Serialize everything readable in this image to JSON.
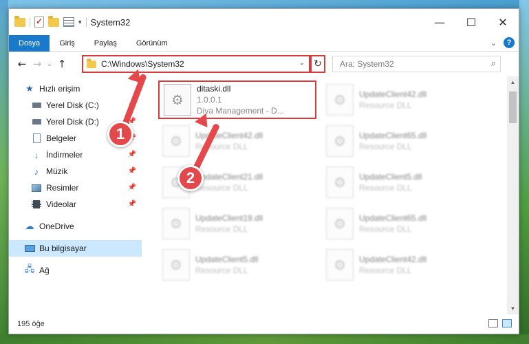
{
  "window": {
    "title": "System32",
    "controls": {
      "minimize": "—",
      "maximize": "☐",
      "close": "✕"
    }
  },
  "ribbon": {
    "tabs": [
      "Dosya",
      "Giriş",
      "Paylaş",
      "Görünüm"
    ],
    "active_tab": "Dosya",
    "help": "?"
  },
  "navigation": {
    "back": "←",
    "forward": "→",
    "recent": "⌄",
    "up": "↑",
    "address": "C:\\Windows\\System32",
    "refresh": "↻",
    "search_placeholder": "Ara: System32"
  },
  "sidebar": {
    "items": [
      {
        "label": "Hızlı erişim",
        "icon": "star-icon"
      },
      {
        "label": "Yerel Disk (C:)",
        "icon": "drive-icon",
        "pinned": true
      },
      {
        "label": "Yerel Disk (D:)",
        "icon": "drive-icon",
        "pinned": true
      },
      {
        "label": "Belgeler",
        "icon": "documents-icon",
        "pinned": true
      },
      {
        "label": "İndirmeler",
        "icon": "download-icon",
        "pinned": true
      },
      {
        "label": "Müzik",
        "icon": "music-icon",
        "pinned": true
      },
      {
        "label": "Resimler",
        "icon": "pictures-icon",
        "pinned": true
      },
      {
        "label": "Videolar",
        "icon": "videos-icon",
        "pinned": true
      },
      {
        "label": "OneDrive",
        "icon": "onedrive-icon"
      },
      {
        "label": "Bu bilgisayar",
        "icon": "computer-icon",
        "selected": true
      },
      {
        "label": "Ağ",
        "icon": "network-icon"
      }
    ]
  },
  "files": [
    {
      "name": "ditaski.dll",
      "line2": "1.0.0.1",
      "line3": "Diva Management - D...",
      "highlighted": true
    },
    {
      "name": "UpdateClient42.dll",
      "line2": "Resource DLL"
    },
    {
      "name": "UpdateClient42.dll",
      "line2": "Resource DLL"
    },
    {
      "name": "UpdateClient65.dll",
      "line2": "Resource DLL"
    },
    {
      "name": "UpdateClient21.dll",
      "line2": "Resource DLL"
    },
    {
      "name": "UpdateClient5.dll",
      "line2": "Resource DLL"
    },
    {
      "name": "UpdateClient19.dll",
      "line2": "Resource DLL"
    },
    {
      "name": "UpdateClient65.dll",
      "line2": "Resource DLL"
    },
    {
      "name": "UpdateClient5.dll",
      "line2": "Resource DLL"
    },
    {
      "name": "UpdateClient42.dll",
      "line2": "Resource DLL"
    }
  ],
  "status": {
    "item_count": "195 öğe"
  },
  "annotations": {
    "callout1": "1",
    "callout2": "2"
  },
  "colors": {
    "accent": "#1979ca",
    "highlight": "#d93a3a",
    "callout": "#e3484b",
    "selection": "#cce8ff"
  }
}
